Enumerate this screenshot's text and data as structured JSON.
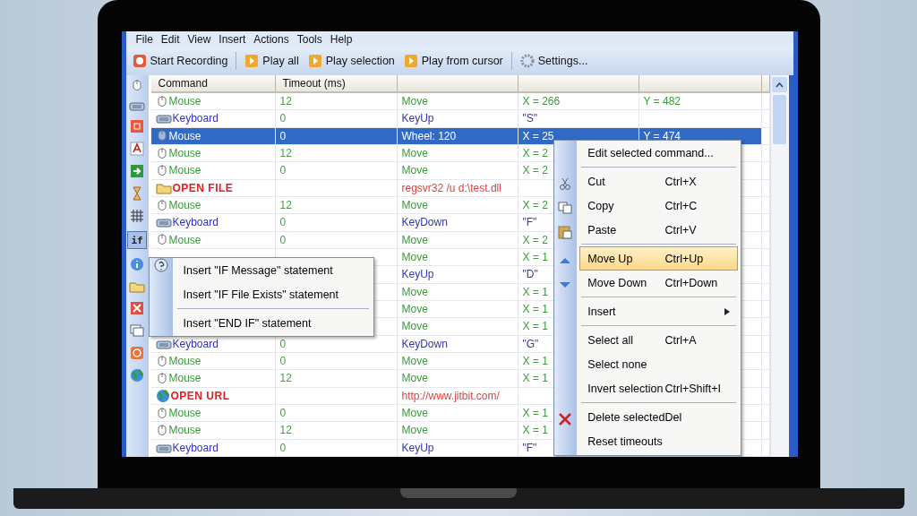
{
  "menu_bar": [
    "File",
    "Edit",
    "View",
    "Insert",
    "Actions",
    "Tools",
    "Help"
  ],
  "toolbar": [
    {
      "kind": "record",
      "label": "Start Recording",
      "separator_after": true
    },
    {
      "kind": "play",
      "label": "Play all",
      "separator_after": false
    },
    {
      "kind": "play",
      "label": "Play selection",
      "separator_after": false
    },
    {
      "kind": "play",
      "label": "Play from cursor",
      "separator_after": true
    },
    {
      "kind": "settings",
      "label": "Settings...",
      "separator_after": false
    }
  ],
  "side_toolbar": {
    "if_button": {
      "label": "if",
      "pressed": true
    }
  },
  "table": {
    "columns": [
      "Command",
      "Timeout (ms)"
    ],
    "rows": [
      {
        "kind": "mouse",
        "selected": false,
        "command": "Mouse",
        "timeout": "12",
        "action": "Move",
        "param_1": "X = 266",
        "param_2": "Y = 482"
      },
      {
        "kind": "keyboard",
        "selected": false,
        "command": "Keyboard",
        "timeout": "0",
        "action": "KeyUp",
        "param_1": "\"S\""
      },
      {
        "kind": "mouse",
        "selected": true,
        "command": "Mouse",
        "timeout": "0",
        "action": "Wheel: 120",
        "param_1": "X = 25",
        "param_2": "Y = 474"
      },
      {
        "kind": "mouse",
        "selected": false,
        "command": "Mouse",
        "timeout": "12",
        "action": "Move",
        "param_1": "X = 2"
      },
      {
        "kind": "mouse",
        "selected": false,
        "command": "Mouse",
        "timeout": "0",
        "action": "Move",
        "param_1": "X = 2"
      },
      {
        "kind": "file",
        "selected": false,
        "command": "OPEN FILE",
        "action": "regsvr32 /u d:\\test.dll"
      },
      {
        "kind": "mouse",
        "selected": false,
        "command": "Mouse",
        "timeout": "12",
        "action": "Move",
        "param_1": "X = 2"
      },
      {
        "kind": "keyboard",
        "selected": false,
        "command": "Keyboard",
        "timeout": "0",
        "action": "KeyDown",
        "param_1": "\"F\""
      },
      {
        "kind": "mouse",
        "selected": false,
        "command": "Mouse",
        "timeout": "0",
        "action": "Move",
        "param_1": "X = 2"
      },
      {
        "kind": "mouse",
        "selected": false,
        "action": "Move",
        "param_1": "X = 1"
      },
      {
        "kind": "keyboard",
        "selected": false,
        "action": "KeyUp",
        "param_1": "\"D\""
      },
      {
        "kind": "mouse",
        "selected": false,
        "action": "Move",
        "param_1": "X = 1"
      },
      {
        "kind": "mouse",
        "selected": false,
        "action": "Move",
        "param_1": "X = 1"
      },
      {
        "kind": "mouse",
        "selected": false,
        "action": "Move",
        "param_1": "X = 1"
      },
      {
        "kind": "keyboard",
        "selected": false,
        "command": "Keyboard",
        "timeout": "0",
        "action": "KeyDown",
        "param_1": "\"G\""
      },
      {
        "kind": "mouse",
        "selected": false,
        "command": "Mouse",
        "timeout": "0",
        "action": "Move",
        "param_1": "X = 1"
      },
      {
        "kind": "mouse",
        "selected": false,
        "command": "Mouse",
        "timeout": "12",
        "action": "Move",
        "param_1": "X = 1"
      },
      {
        "kind": "url",
        "selected": false,
        "command": "OPEN URL",
        "action": "http://www.jitbit.com/"
      },
      {
        "kind": "mouse",
        "selected": false,
        "command": "Mouse",
        "timeout": "0",
        "action": "Move",
        "param_1": "X = 1"
      },
      {
        "kind": "mouse",
        "selected": false,
        "command": "Mouse",
        "timeout": "12",
        "action": "Move",
        "param_1": "X = 1"
      },
      {
        "kind": "keyboard",
        "selected": false,
        "command": "Keyboard",
        "timeout": "0",
        "action": "KeyUp",
        "param_1": "\"F\""
      }
    ]
  },
  "if_menu": [
    {
      "label": "Insert \"IF Message\" statement",
      "separator_before": false
    },
    {
      "label": "Insert \"IF File Exists\" statement",
      "separator_before": false
    },
    {
      "label": "Insert \"END IF\" statement",
      "separator_before": true
    }
  ],
  "context_menu": [
    {
      "label": "Edit selected command...",
      "selected": false,
      "separator_before": false,
      "submenu": false
    },
    {
      "label": "Cut",
      "shortcut": "Ctrl+X",
      "selected": false,
      "separator_before": true,
      "submenu": false
    },
    {
      "label": "Copy",
      "shortcut": "Ctrl+C",
      "selected": false,
      "separator_before": false,
      "submenu": false
    },
    {
      "label": "Paste",
      "shortcut": "Ctrl+V",
      "selected": false,
      "separator_before": false,
      "submenu": false
    },
    {
      "label": "Move Up",
      "shortcut": "Ctrl+Up",
      "selected": true,
      "separator_before": true,
      "submenu": false
    },
    {
      "label": "Move Down",
      "shortcut": "Ctrl+Down",
      "selected": false,
      "separator_before": false,
      "submenu": false
    },
    {
      "label": "Insert",
      "selected": false,
      "separator_before": true,
      "submenu": true
    },
    {
      "label": "Select all",
      "shortcut": "Ctrl+A",
      "selected": false,
      "separator_before": true,
      "submenu": false
    },
    {
      "label": "Select none",
      "selected": false,
      "separator_before": false,
      "submenu": false
    },
    {
      "label": "Invert selection",
      "shortcut": "Ctrl+Shift+I",
      "selected": false,
      "separator_before": false,
      "submenu": false
    },
    {
      "label": "Delete selected",
      "shortcut": "Del",
      "selected": false,
      "separator_before": true,
      "submenu": false
    },
    {
      "label": "Reset timeouts",
      "selected": false,
      "separator_before": false,
      "submenu": false
    }
  ]
}
